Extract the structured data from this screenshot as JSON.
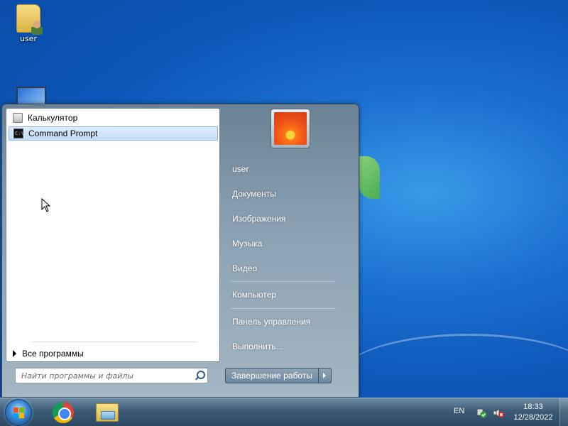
{
  "desktop": {
    "icons": [
      {
        "label": "user"
      },
      {
        "label": ""
      }
    ]
  },
  "start_menu": {
    "programs": [
      {
        "label": "Калькулятор",
        "icon": "calculator-icon"
      },
      {
        "label": "Command Prompt",
        "icon": "command-prompt-icon",
        "selected": true
      }
    ],
    "all_programs": "Все программы",
    "search_placeholder": "Найти программы и файлы",
    "right_items": [
      "user",
      "Документы",
      "Изображения",
      "Музыка",
      "Видео",
      "Компьютер",
      "Панель управления",
      "Выполнить..."
    ],
    "shutdown_label": "Завершение работы"
  },
  "taskbar": {
    "pinned": [
      "start-orb",
      "chrome-icon",
      "explorer-icon"
    ],
    "language": "EN",
    "time": "18:33",
    "date": "12/28/2022"
  },
  "colors": {
    "desktop_blue": "#1a6fd0",
    "selection": "#c3dcf5",
    "taskbar": "#3d5a77"
  }
}
